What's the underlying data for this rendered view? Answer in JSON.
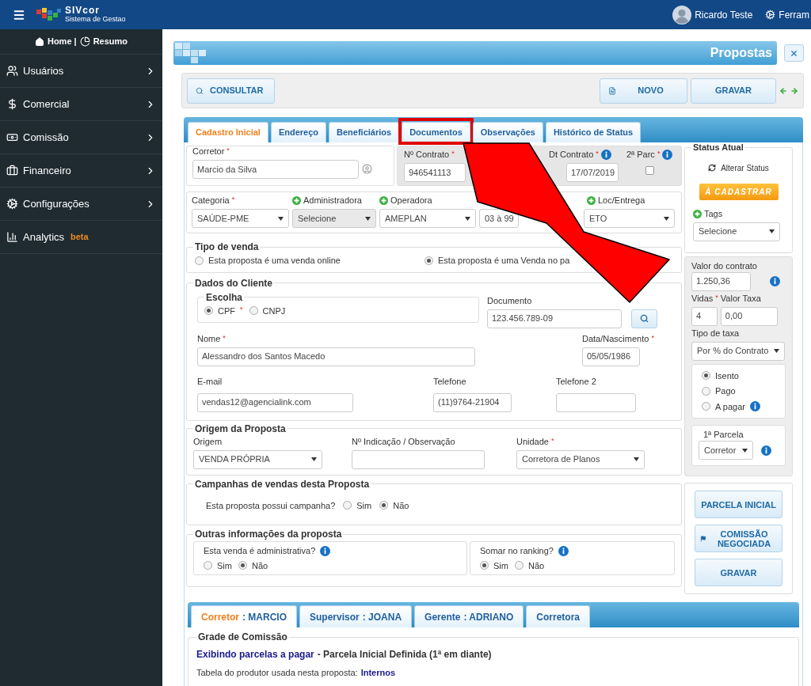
{
  "topbar": {
    "brand": "SIVcor",
    "brand_subtitle": "Sistema de Gestao",
    "user": "Ricardo Teste",
    "tools": "Ferram"
  },
  "sidebar": {
    "home": "Home |",
    "summary": "Resumo",
    "items": [
      {
        "label": "Usuários"
      },
      {
        "label": "Comercial"
      },
      {
        "label": "Comissão"
      },
      {
        "label": "Financeiro"
      },
      {
        "label": "Configurações"
      },
      {
        "label": "Analytics",
        "badge": "beta"
      }
    ]
  },
  "page": {
    "title": "Propostas"
  },
  "toolbar": [
    {
      "label": "CONSULTAR"
    },
    {
      "label": "NOVO"
    },
    {
      "label": "GRAVAR"
    }
  ],
  "tabs": [
    {
      "label": "Cadastro Inicial",
      "selected": true,
      "highlighted": false
    },
    {
      "label": "Endereço",
      "selected": false,
      "highlighted": false
    },
    {
      "label": "Beneficiários",
      "selected": false,
      "highlighted": false
    },
    {
      "label": "Documentos",
      "selected": false,
      "highlighted": true
    },
    {
      "label": "Observações",
      "selected": false,
      "highlighted": false
    },
    {
      "label": "Histórico de Status",
      "selected": false,
      "highlighted": false
    }
  ],
  "broker": {
    "label": "Corretor",
    "mark": "*",
    "kind": "text",
    "value": "Marcio da Silva"
  },
  "contract": [
    {
      "label": "Nº Contrato",
      "mark": "*",
      "kind": "text",
      "value": "946541113"
    },
    {
      "label": "Dt Contrato",
      "mark": "*",
      "info": true,
      "kind": "text",
      "value": "17/07/2019"
    },
    {
      "label": "2ª Parc",
      "mark": "*",
      "info": true,
      "kind": "checkbox",
      "checked": false
    }
  ],
  "plan": [
    {
      "label": "Categoria",
      "mark": "*",
      "kind": "select",
      "value": "SAÚDE-PME"
    },
    {
      "label": "Administradora",
      "add": true,
      "kind": "select",
      "value": "Selecione",
      "disabled": true
    },
    {
      "label": "Operadora",
      "add": true,
      "kind": "select",
      "value": "AMEPLAN"
    },
    {
      "kind": "select",
      "value": "03 à 99"
    },
    {
      "label": "Loc/Entrega",
      "add": true,
      "kind": "select",
      "value": "ETO"
    }
  ],
  "sale_type": {
    "title": "Tipo de venda",
    "options": [
      {
        "label": "Esta proposta é uma venda online",
        "selected": false
      },
      {
        "label": "Esta proposta é uma Venda no pa",
        "selected": true
      }
    ]
  },
  "client": {
    "title": "Dados do Cliente",
    "choice": {
      "title": "Escolha",
      "options": [
        {
          "label": "CPF",
          "mark": "*",
          "selected": true
        },
        {
          "label": "CNPJ",
          "selected": false
        }
      ]
    },
    "document": {
      "label": "Documento",
      "kind": "text",
      "value": "123.456.789-09"
    },
    "name": {
      "label": "Nome",
      "mark": "*",
      "kind": "text",
      "value": "Alessandro dos Santos Macedo"
    },
    "birth": {
      "label": "Data/Nascimento",
      "mark": "*",
      "kind": "text",
      "value": "05/05/1986"
    },
    "email": {
      "label": "E-mail",
      "kind": "text",
      "value": "vendas12@agencialink.com"
    },
    "phone": {
      "label": "Telefone",
      "kind": "text",
      "value": "(11)9764-21904"
    },
    "phone2": {
      "label": "Telefone 2",
      "kind": "text"
    }
  },
  "origin": {
    "title": "Origem da Proposta",
    "fields": [
      {
        "label": "Origem",
        "kind": "select",
        "value": "VENDA PRÓPRIA"
      },
      {
        "label": "Nº Indicação / Observação",
        "kind": "text"
      },
      {
        "label": "Unidade",
        "mark": "*",
        "kind": "select",
        "value": "Corretora de Planos"
      }
    ]
  },
  "campaign": {
    "title": "Campanhas de vendas desta Proposta",
    "question": "Esta proposta possui campanha?",
    "options": [
      {
        "label": "Sim",
        "selected": false
      },
      {
        "label": "Não",
        "selected": true
      }
    ]
  },
  "other": {
    "title": "Outras informações da proposta",
    "groups": [
      {
        "question": "Esta venda é administrativa?",
        "info": true,
        "options": [
          {
            "label": "Sim",
            "selected": false
          },
          {
            "label": "Não",
            "selected": true
          }
        ]
      },
      {
        "question": "Somar no ranking?",
        "info": true,
        "options": [
          {
            "label": "Sim",
            "selected": true
          },
          {
            "label": "Não",
            "selected": false
          }
        ]
      }
    ]
  },
  "status": {
    "title": "Status Atual",
    "change": "Alterar Status",
    "badge": "À CADASTRAR",
    "tags": {
      "label": "Tags",
      "add": true,
      "kind": "select",
      "value": "Selecione"
    }
  },
  "values": {
    "contract_value": {
      "label": "Valor do contrato",
      "kind": "text",
      "value": "1.250,36",
      "info": true
    },
    "lives": {
      "label": "Vidas",
      "mark": "*",
      "kind": "text",
      "value": "4"
    },
    "fee": {
      "label": "Valor Taxa",
      "kind": "text",
      "value": "0,00"
    },
    "fee_type": {
      "label": "Tipo de taxa",
      "kind": "select",
      "value": "Por % do Contrato"
    },
    "fee_options": [
      {
        "label": "Isento",
        "selected": true
      },
      {
        "label": "Pago",
        "selected": false
      },
      {
        "label": "A pagar",
        "selected": false,
        "info": true
      }
    ],
    "first_installment": {
      "label": "1ª Parcela",
      "kind": "select",
      "value": "Corretor",
      "info": true
    }
  },
  "actions": [
    {
      "label": "PARCELA INICIAL"
    },
    {
      "label": "COMISSÃO NEGOCIADA"
    },
    {
      "label": "GRAVAR"
    }
  ],
  "commission_tabs": [
    {
      "label": "Corretor",
      "detail": ": MARCIO",
      "selected": true
    },
    {
      "label": "Supervisor",
      "detail": ": JOANA",
      "selected": false
    },
    {
      "label": "Gerente",
      "detail": ": ADRIANO",
      "selected": false
    },
    {
      "label": "Corretora",
      "selected": false
    }
  ],
  "commission": {
    "title": "Grade de Comissão",
    "summary_highlight": "Exibindo parcelas a pagar",
    "summary": "- Parcela Inicial Definida (1ª em diante)",
    "table_label": "Tabela do produtor usada nesta proposta:",
    "table": "Internos"
  }
}
